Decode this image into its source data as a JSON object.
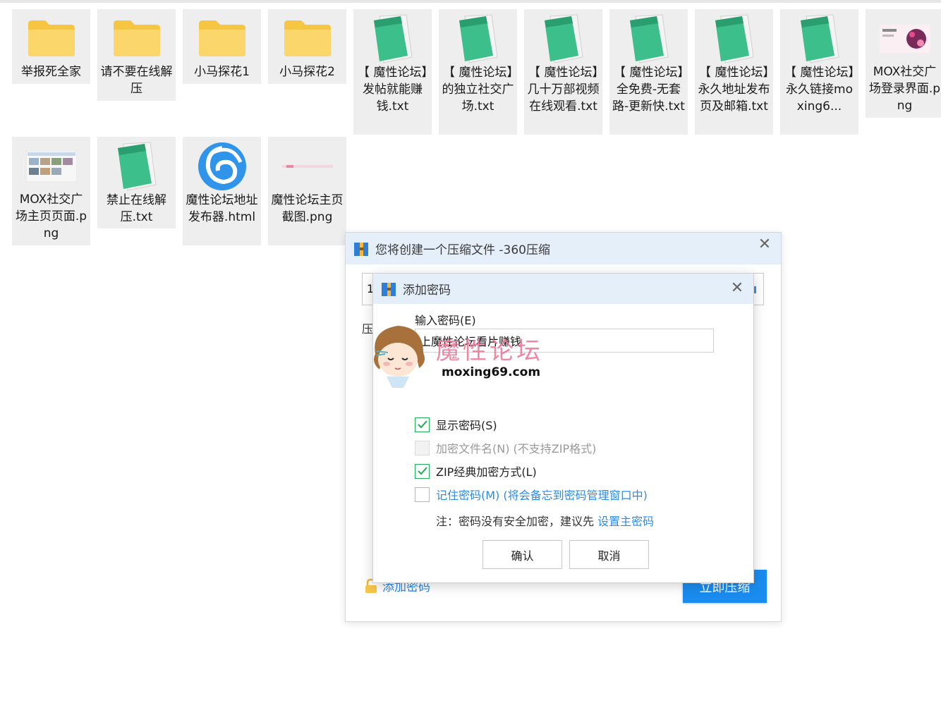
{
  "files": [
    {
      "name": "举报死全家",
      "type": "folder"
    },
    {
      "name": "请不要在线解压",
      "type": "folder"
    },
    {
      "name": "小马探花1",
      "type": "folder"
    },
    {
      "name": "小马探花2",
      "type": "folder"
    },
    {
      "name": "【 魔性论坛】发帖就能赚钱.txt",
      "type": "notepad"
    },
    {
      "name": "【 魔性论坛】的独立社交广场.txt",
      "type": "notepad"
    },
    {
      "name": "【 魔性论坛】几十万部视频在线观看.txt",
      "type": "notepad"
    },
    {
      "name": "【 魔性论坛】全免费-无套路-更新快.txt",
      "type": "notepad"
    },
    {
      "name": "【 魔性论坛】永久地址发布页及邮箱.txt",
      "type": "notepad"
    },
    {
      "name": "【 魔性论坛】永久链接moxing6...",
      "type": "notepad"
    },
    {
      "name": "MOX社交广场登录界面.png",
      "type": "image-dark"
    },
    {
      "name": "MOX社交广场主页页面.png",
      "type": "image-light"
    },
    {
      "name": "禁止在线解压.txt",
      "type": "notepad"
    },
    {
      "name": "魔性论坛地址发布器.html",
      "type": "browser"
    },
    {
      "name": "魔性论坛主页截图.png",
      "type": "image-strip"
    }
  ],
  "compress_window": {
    "title": "您将创建一个压缩文件 -360压缩",
    "path_value": "1",
    "press_label": "压",
    "add_password_link": "添加密码",
    "compress_button": "立即压缩"
  },
  "password_dialog": {
    "title": "添加密码",
    "input_label": "输入密码(E)",
    "password_value": "上魔性论坛看片赚钱",
    "options": [
      {
        "label": "显示密码(S)",
        "checked": true,
        "disabled": false
      },
      {
        "label": "加密文件名(N) (不支持ZIP格式)",
        "checked": false,
        "disabled": true
      },
      {
        "label": "ZIP经典加密方式(L)",
        "checked": true,
        "disabled": false
      },
      {
        "label": "记住密码(M) (将会备忘到密码管理窗口中)",
        "checked": false,
        "disabled": false
      }
    ],
    "note_prefix": "注：密码没有安全加密，建议先 ",
    "note_link": "设置主密码",
    "ok_button": "确认",
    "cancel_button": "取消"
  },
  "watermark": {
    "text": "魔性论坛",
    "url": "moxing69.com"
  },
  "colors": {
    "title_bar": "#e4eff9",
    "accent_blue": "#1a8cf0",
    "check_green": "#1fae58",
    "tile_bg": "#eeeeee"
  }
}
